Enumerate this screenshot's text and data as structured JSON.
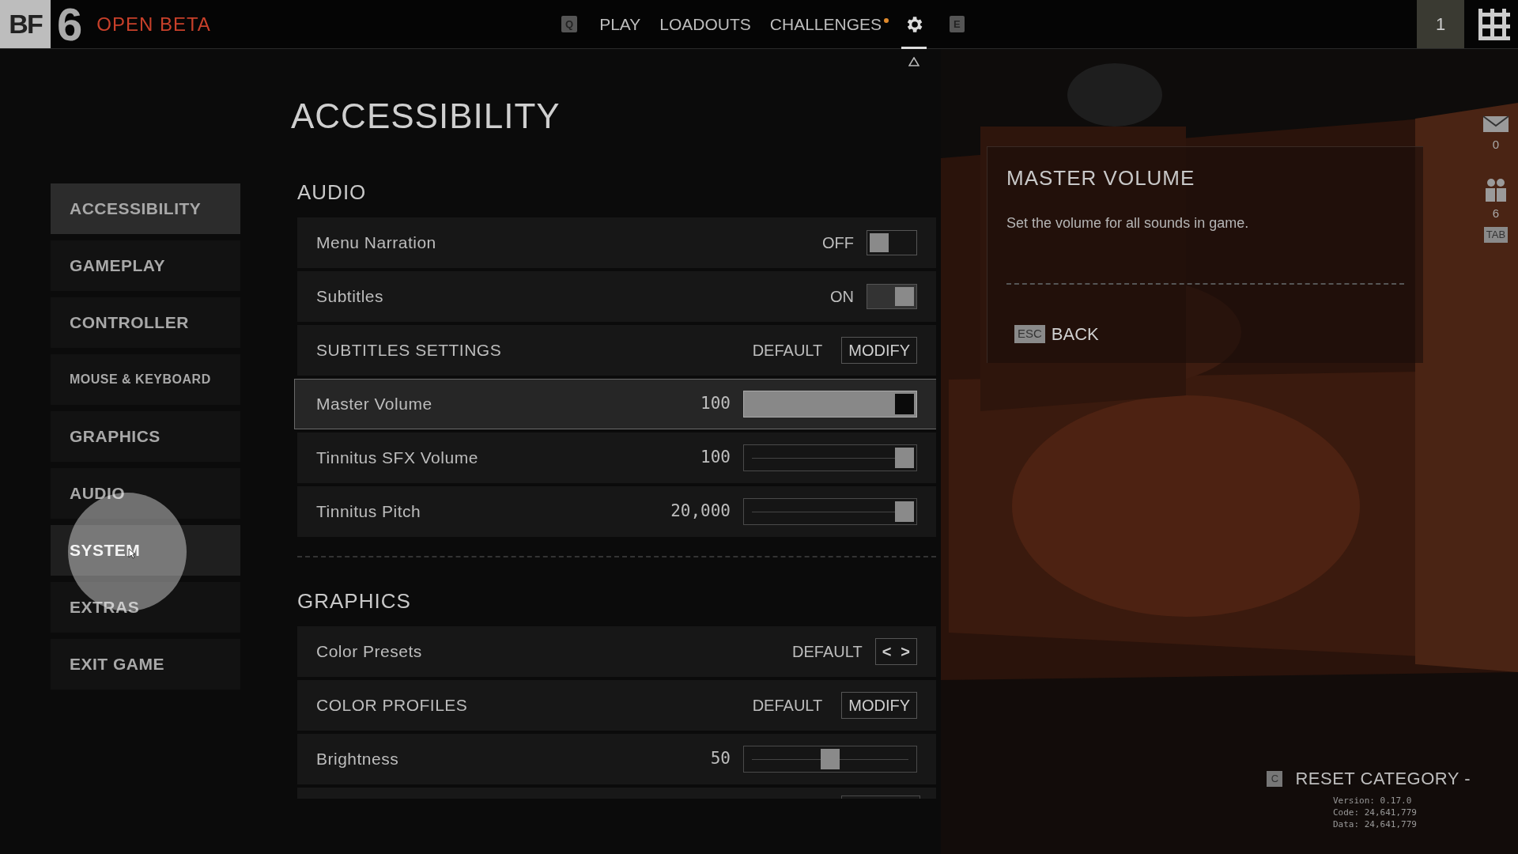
{
  "top_bar": {
    "logo_letters": "BF",
    "logo_number": "6",
    "logo_caption": "OPEN BETA",
    "nav": [
      {
        "kind": "key",
        "label": "Q"
      },
      {
        "kind": "link",
        "label": "PLAY",
        "selected": false,
        "notify": false
      },
      {
        "kind": "link",
        "label": "LOADOUTS",
        "selected": false,
        "notify": false
      },
      {
        "kind": "link",
        "label": "CHALLENGES",
        "selected": false,
        "notify": true
      },
      {
        "kind": "gear",
        "selected": true
      },
      {
        "kind": "key",
        "label": "E"
      }
    ],
    "player_level": "1"
  },
  "page_title": "ACCESSIBILITY",
  "sidebar": {
    "items": [
      {
        "label": "ACCESSIBILITY",
        "selected": true,
        "hovered": false
      },
      {
        "label": "GAMEPLAY",
        "selected": false,
        "hovered": false
      },
      {
        "label": "CONTROLLER",
        "selected": false,
        "hovered": false
      },
      {
        "label": "MOUSE & KEYBOARD",
        "selected": false,
        "hovered": false,
        "small": true
      },
      {
        "label": "GRAPHICS",
        "selected": false,
        "hovered": false
      },
      {
        "label": "AUDIO",
        "selected": false,
        "hovered": false
      },
      {
        "label": "SYSTEM",
        "selected": false,
        "hovered": true
      },
      {
        "label": "EXTRAS",
        "selected": false,
        "hovered": false
      },
      {
        "label": "EXIT GAME",
        "selected": false,
        "hovered": false
      }
    ]
  },
  "sections": [
    {
      "title": "AUDIO",
      "rows": [
        {
          "kind": "toggle",
          "label": "Menu Narration",
          "value": "OFF",
          "on": false,
          "selected": false
        },
        {
          "kind": "toggle",
          "label": "Subtitles",
          "value": "ON",
          "on": true,
          "selected": false
        },
        {
          "kind": "modify",
          "label": "SUBTITLES SETTINGS",
          "value": "DEFAULT",
          "button": "MODIFY",
          "selected": false
        },
        {
          "kind": "slider",
          "label": "Master Volume",
          "reading": "100",
          "level": 1,
          "selected": true
        },
        {
          "kind": "slider",
          "label": "Tinnitus SFX Volume",
          "reading": "100",
          "level": 1,
          "selected": false
        },
        {
          "kind": "slider",
          "label": "Tinnitus Pitch",
          "reading": "20,000",
          "level": 1,
          "selected": false
        }
      ]
    },
    {
      "title": "GRAPHICS",
      "rows": [
        {
          "kind": "stepper",
          "label": "Color Presets",
          "value": "DEFAULT",
          "previous": "<",
          "next": ">",
          "selected": false
        },
        {
          "kind": "modify",
          "label": "COLOR PROFILES",
          "value": "DEFAULT",
          "button": "MODIFY",
          "selected": false
        },
        {
          "kind": "slider",
          "label": "Brightness",
          "reading": "50",
          "level": 0.5,
          "selected": false
        },
        {
          "kind": "cut_off"
        }
      ]
    }
  ],
  "info_panel": {
    "title": "MASTER VOLUME",
    "description": "Set the volume for all sounds in game.",
    "back_key": "ESC",
    "back_label": "BACK"
  },
  "right_rail": {
    "messages_count": "0",
    "squad_count": "6",
    "squad_key": "TAB"
  },
  "footer": {
    "reset_key": "C",
    "reset_label": "RESET CATEGORY -",
    "version": "Version: 0.17.0",
    "code": "Code: 24,641,779",
    "data": "Data: 24,641,779"
  }
}
